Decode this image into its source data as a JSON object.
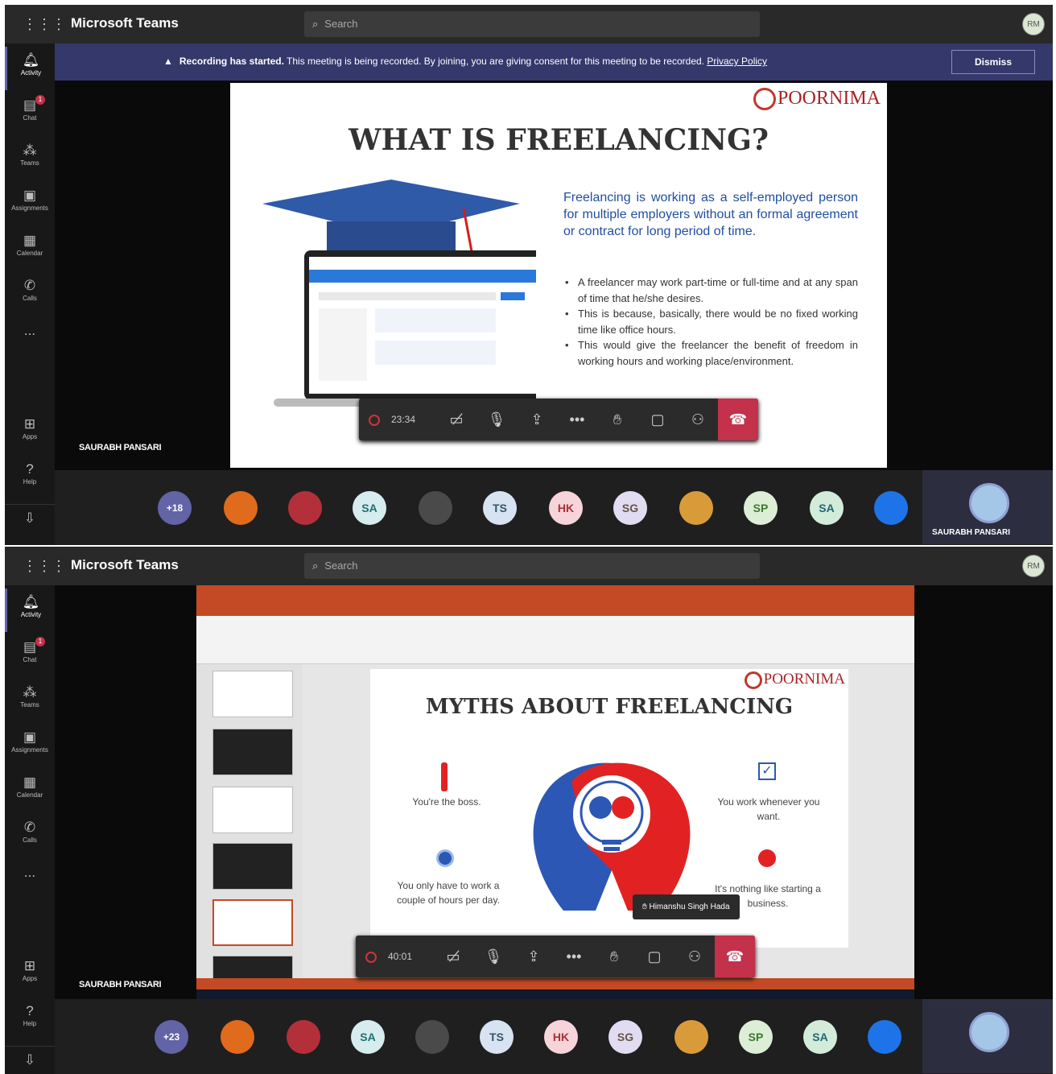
{
  "top": {
    "app_title": "Microsoft Teams",
    "search_placeholder": "Search",
    "avatar": "RM",
    "rail": [
      {
        "label": "Activity",
        "icon": "bell-icon"
      },
      {
        "label": "Chat",
        "icon": "chat-icon",
        "badge": "1"
      },
      {
        "label": "Teams",
        "icon": "teams-icon"
      },
      {
        "label": "Assignments",
        "icon": "assignments-icon"
      },
      {
        "label": "Calendar",
        "icon": "calendar-icon"
      },
      {
        "label": "Calls",
        "icon": "phone-icon"
      },
      {
        "label": "...",
        "icon": "more-icon"
      },
      {
        "label": "Apps",
        "icon": "apps-icon"
      },
      {
        "label": "Help",
        "icon": "help-icon"
      }
    ],
    "banner": {
      "bold": "Recording has started.",
      "text": "This meeting is being recorded. By joining, you are giving consent for this meeting to be recorded.",
      "link": "Privacy Policy",
      "dismiss": "Dismiss"
    },
    "slide": {
      "logo": "POORNIMA",
      "title": "WHAT IS FREELANCING?",
      "definition": "Freelancing is working as a self-employed person for multiple employers without an formal agreement or contract for long period of time.",
      "bullets": [
        "A freelancer may work part-time or full-time and at any span of time that he/she desires.",
        "This is because, basically, there would be no fixed working time like office hours.",
        "This would give the freelancer the benefit of freedom in working hours and working place/environment."
      ]
    },
    "presenter": "SAURABH PANSARI",
    "timer": "23:34",
    "participants": [
      "+18",
      "",
      "",
      "SA",
      "",
      "TS",
      "HK",
      "SG",
      "",
      "SP",
      "SA",
      ""
    ],
    "self_name": "SAURABH PANSARI"
  },
  "bottom": {
    "app_title": "Microsoft Teams",
    "search_placeholder": "Search",
    "avatar": "RM",
    "slide": {
      "logo": "POORNIMA",
      "title": "MYTHS ABOUT FREELANCING",
      "myths": [
        "You're the boss.",
        "You work whenever you want.",
        "You only have to work a couple of hours per day.",
        "It's nothing like starting a business."
      ]
    },
    "tooltip": "Himanshu Singh Hada",
    "presenter": "SAURABH PANSARI",
    "timer": "40:01",
    "participants": [
      "+23",
      "",
      "",
      "SA",
      "",
      "TS",
      "HK",
      "SG",
      "",
      "SP",
      "SA",
      ""
    ]
  },
  "colors": {
    "accent": "#6264a7",
    "hangup": "#c4314b",
    "banner": "#34386b",
    "ppt": "#c34a24"
  }
}
